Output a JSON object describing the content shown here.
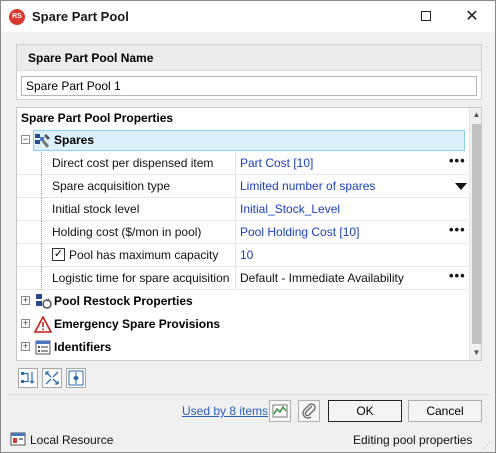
{
  "window": {
    "title": "Spare Part Pool",
    "app_icon_text": "RS",
    "minimize_label": "",
    "close_label": "✕"
  },
  "name_section": {
    "header": "Spare Part Pool Name",
    "value": "Spare Part Pool 1"
  },
  "properties": {
    "header": "Spare Part Pool Properties",
    "categories": [
      {
        "label": "Spares",
        "expander": "−",
        "icon": "spares-icon",
        "expanded": true
      },
      {
        "label": "Pool Restock Properties",
        "expander": "+",
        "icon": "restock-icon"
      },
      {
        "label": "Emergency Spare Provisions",
        "expander": "+",
        "icon": "warning-icon"
      },
      {
        "label": "Identifiers",
        "expander": "+",
        "icon": "identifiers-icon"
      }
    ],
    "rows": [
      {
        "name": "Direct cost per dispensed item",
        "value": "Part Cost [10]",
        "control": "ellipsis"
      },
      {
        "name": "Spare acquisition type",
        "value": "Limited number of spares",
        "control": "dropdown"
      },
      {
        "name": "Initial stock level",
        "value": "Initial_Stock_Level",
        "control": "none"
      },
      {
        "name": "Holding cost ($/mon in pool)",
        "value": "Pool Holding Cost [10]",
        "control": "ellipsis"
      },
      {
        "name": "Pool has maximum capacity",
        "value": "10",
        "control": "none",
        "checked": true
      },
      {
        "name": "Logistic time for spare acquisition",
        "value": "Default - Immediate Availability",
        "control": "ellipsis"
      }
    ],
    "ellipsis_text": "•••",
    "checkmark": "✓"
  },
  "toolbar": {
    "buttons": [
      "sort-categorized-icon",
      "expand-collapse-icon",
      "properties-page-icon"
    ]
  },
  "footer": {
    "used_by": "Used by 8 items",
    "ok": "OK",
    "cancel": "Cancel"
  },
  "status": {
    "left": "Local Resource",
    "right": "Editing pool properties"
  },
  "colors": {
    "value_blue": "#1c3fbf",
    "selection": "#dcf0fb",
    "link": "#2b5fb8"
  }
}
